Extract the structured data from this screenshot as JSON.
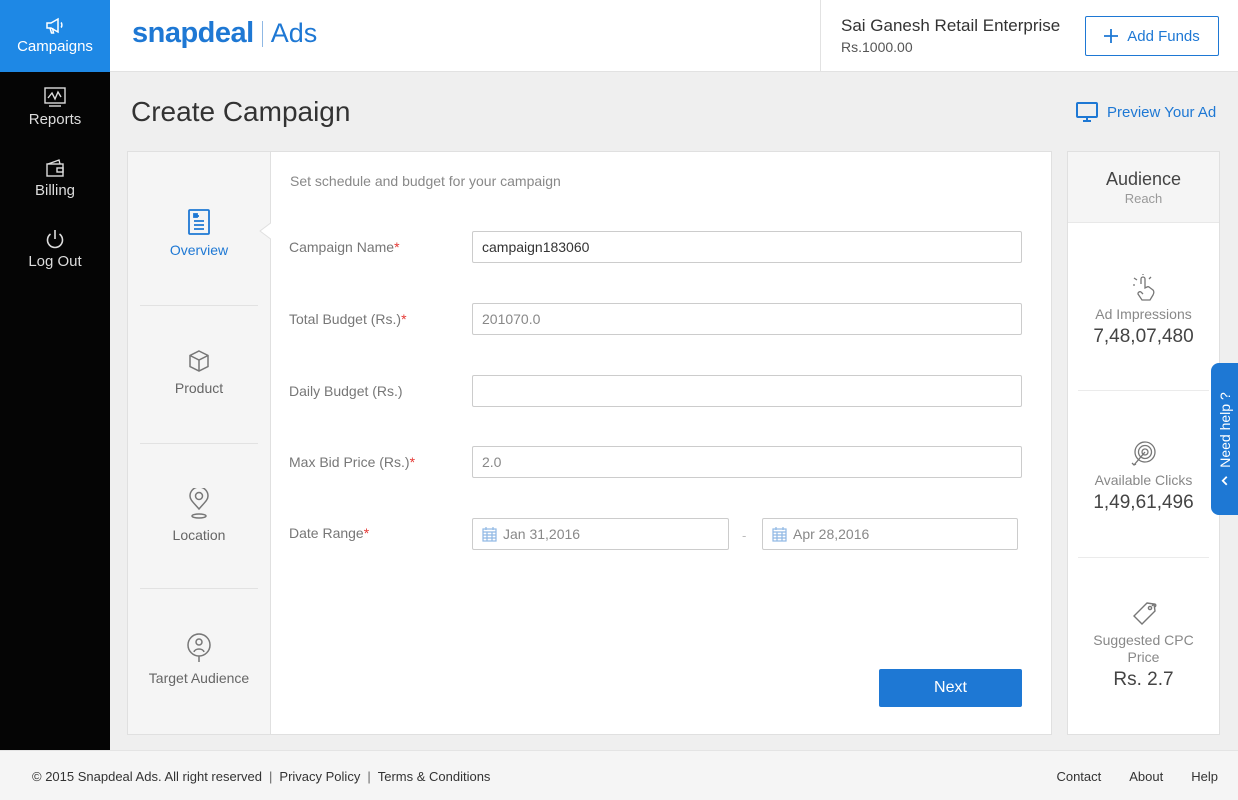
{
  "nav": {
    "items": [
      {
        "label": "Campaigns",
        "icon": "megaphone-icon",
        "active": true
      },
      {
        "label": "Reports",
        "icon": "chart-icon"
      },
      {
        "label": "Billing",
        "icon": "wallet-icon"
      },
      {
        "label": "Log Out",
        "icon": "power-icon"
      }
    ]
  },
  "header": {
    "logo_main": "snapdeal",
    "logo_ads": "Ads",
    "account_name": "Sai Ganesh Retail Enterprise",
    "account_balance": "Rs.1000.00",
    "add_funds_label": "Add Funds"
  },
  "page": {
    "title": "Create Campaign",
    "preview_label": "Preview Your Ad"
  },
  "steps": [
    {
      "label": "Overview",
      "icon": "document-icon",
      "active": true
    },
    {
      "label": "Product",
      "icon": "box-icon"
    },
    {
      "label": "Location",
      "icon": "location-pin-icon"
    },
    {
      "label": "Target Audience",
      "icon": "target-audience-icon"
    }
  ],
  "form": {
    "subtitle": "Set schedule and budget for your campaign",
    "campaign_name": {
      "label": "Campaign Name",
      "required": "*",
      "value": "campaign183060"
    },
    "total_budget": {
      "label": "Total Budget (Rs.)",
      "required": "*",
      "value": "201070.0"
    },
    "daily_budget": {
      "label": "Daily Budget (Rs.)",
      "value": ""
    },
    "max_bid": {
      "label": "Max Bid Price (Rs.)",
      "required": "*",
      "value": "2.0"
    },
    "date_range": {
      "label": "Date Range",
      "required": "*",
      "start": "Jan 31,2016",
      "separator": "-",
      "end": "Apr 28,2016"
    },
    "next_label": "Next"
  },
  "audience": {
    "title": "Audience",
    "subtitle": "Reach",
    "metrics": [
      {
        "label": "Ad Impressions",
        "value": "7,48,07,480",
        "icon": "tap-icon"
      },
      {
        "label": "Available Clicks",
        "value": "1,49,61,496",
        "icon": "target-icon"
      },
      {
        "label": "Suggested CPC Price",
        "value": "Rs. 2.7",
        "icon": "price-tag-icon"
      }
    ]
  },
  "need_help": "Need help ?",
  "footer": {
    "copyright": "© 2015 Snapdeal Ads. All right reserved",
    "sep": "|",
    "privacy": "Privacy Policy",
    "terms": "Terms & Conditions",
    "links": [
      "Contact",
      "About",
      "Help"
    ]
  },
  "colors": {
    "accent": "#1e78d4",
    "nav_active": "#1e88e5",
    "nav_bg": "#050505",
    "required": "#e53935"
  }
}
